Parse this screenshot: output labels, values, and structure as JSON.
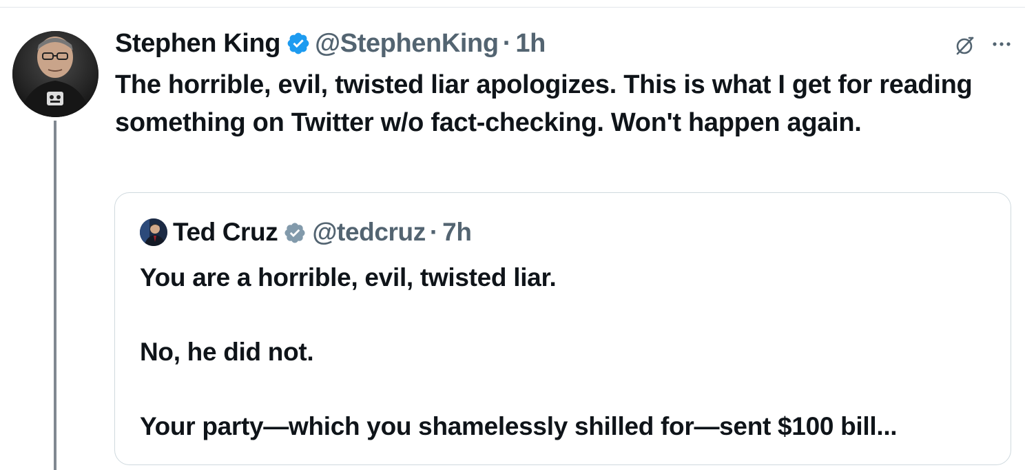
{
  "post": {
    "display_name": "Stephen King",
    "handle": "@StephenKing",
    "separator": "·",
    "time": "1h",
    "text": "The horrible, evil, twisted liar apologizes. This is what I get for reading something on Twitter w/o fact-checking. Won't happen again.",
    "verified_color": "#1d9bf0",
    "icons": [
      "avatar",
      "verified-badge-icon",
      "grok-icon",
      "more-options-icon"
    ]
  },
  "quoted_post": {
    "display_name": "Ted Cruz",
    "handle": "@tedcruz",
    "separator": "·",
    "time": "7h",
    "text": "You are a horrible, evil, twisted liar.\n\nNo, he did not.\n\nYour party—which you shamelessly shilled for—sent $100 bill...",
    "verified_color": "#829aab",
    "icons": [
      "avatar",
      "verified-badge-icon"
    ]
  },
  "colors": {
    "secondary_text": "#536471",
    "thread_line": "#808891",
    "card_border": "#cfd9de"
  }
}
